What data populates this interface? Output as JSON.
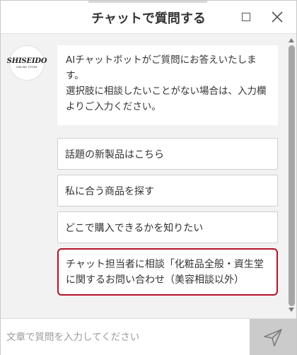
{
  "header": {
    "title": "チャットで質問する",
    "icons": {
      "maximize": "maximize-icon",
      "close": "close-icon"
    }
  },
  "bot": {
    "logo_text": "SHISEIDO",
    "logo_subtext": "ONLINE STORE",
    "message_lines": [
      "AIチャットボットがご質問にお答えいたします。",
      "選択肢に相談したいことがない場合は、入力欄よりご入力ください。"
    ]
  },
  "options": [
    {
      "label": "話題の新製品はこちら"
    },
    {
      "label": "私に合う商品を探す"
    },
    {
      "label": "どこで購入できるかを知りたい"
    },
    {
      "label": "チャット担当者に相談「化粧品全般・資生堂に関するお問い合わせ（美容相談以外）",
      "selected": true
    }
  ],
  "input": {
    "placeholder": "文章で質問を入力してください",
    "value": ""
  },
  "send": {
    "icon": "send-icon"
  },
  "colors": {
    "accent_border": "#b5122a",
    "background": "#f2f2f2",
    "send_button": "#cbcbcb"
  }
}
